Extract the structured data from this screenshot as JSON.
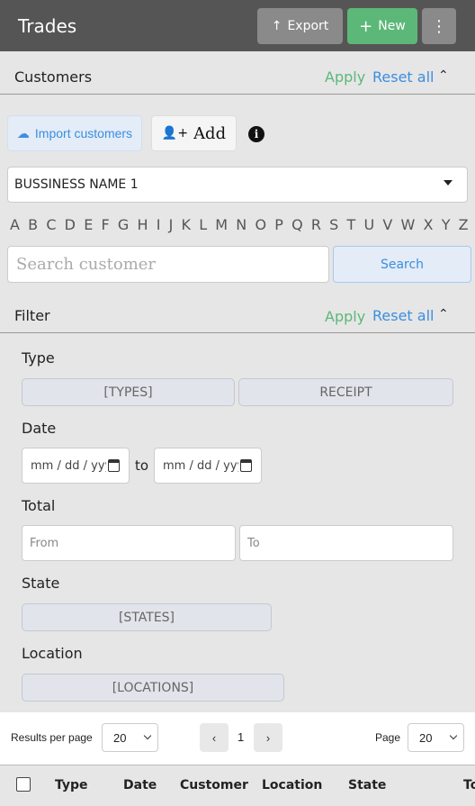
{
  "header": {
    "title": "Trades",
    "export_label": "Export",
    "new_label": "New"
  },
  "customers": {
    "title": "Customers",
    "apply_label": "Apply",
    "reset_label": "Reset all",
    "import_label": "Import customers",
    "add_label": "Add",
    "business_selected": "BUSSINESS NAME 1",
    "alphabet": [
      "A",
      "B",
      "C",
      "D",
      "E",
      "F",
      "G",
      "H",
      "I",
      "J",
      "K",
      "L",
      "M",
      "N",
      "O",
      "P",
      "Q",
      "R",
      "S",
      "T",
      "U",
      "V",
      "W",
      "X",
      "Y",
      "Z"
    ],
    "search_placeholder": "Search customer",
    "search_button": "Search"
  },
  "filter": {
    "title": "Filter",
    "apply_label": "Apply",
    "reset_label": "Reset all",
    "type_label": "Type",
    "type_options": [
      "[TYPES]",
      "RECEIPT"
    ],
    "date_label": "Date",
    "date_from_placeholder": "mm / dd / yyyy",
    "date_to_label": "to",
    "date_to_placeholder": "mm / dd / yyyy",
    "total_label": "Total",
    "total_from_placeholder": "From",
    "total_to_placeholder": "To",
    "state_label": "State",
    "state_value": "[STATES]",
    "location_label": "Location",
    "location_value": "[LOCATIONS]"
  },
  "pager": {
    "results_per_page_label": "Results per page",
    "results_per_page_value": "20",
    "prev": "‹",
    "current_page": "1",
    "next": "›",
    "page_label": "Page",
    "page_value": "20"
  },
  "table": {
    "columns": [
      "Type",
      "Date",
      "Customer",
      "Location",
      "State",
      "To"
    ]
  },
  "colors": {
    "header_bg": "#555555",
    "new_button": "#5cb878",
    "apply": "#5cb878",
    "reset": "#3b8ee0"
  }
}
